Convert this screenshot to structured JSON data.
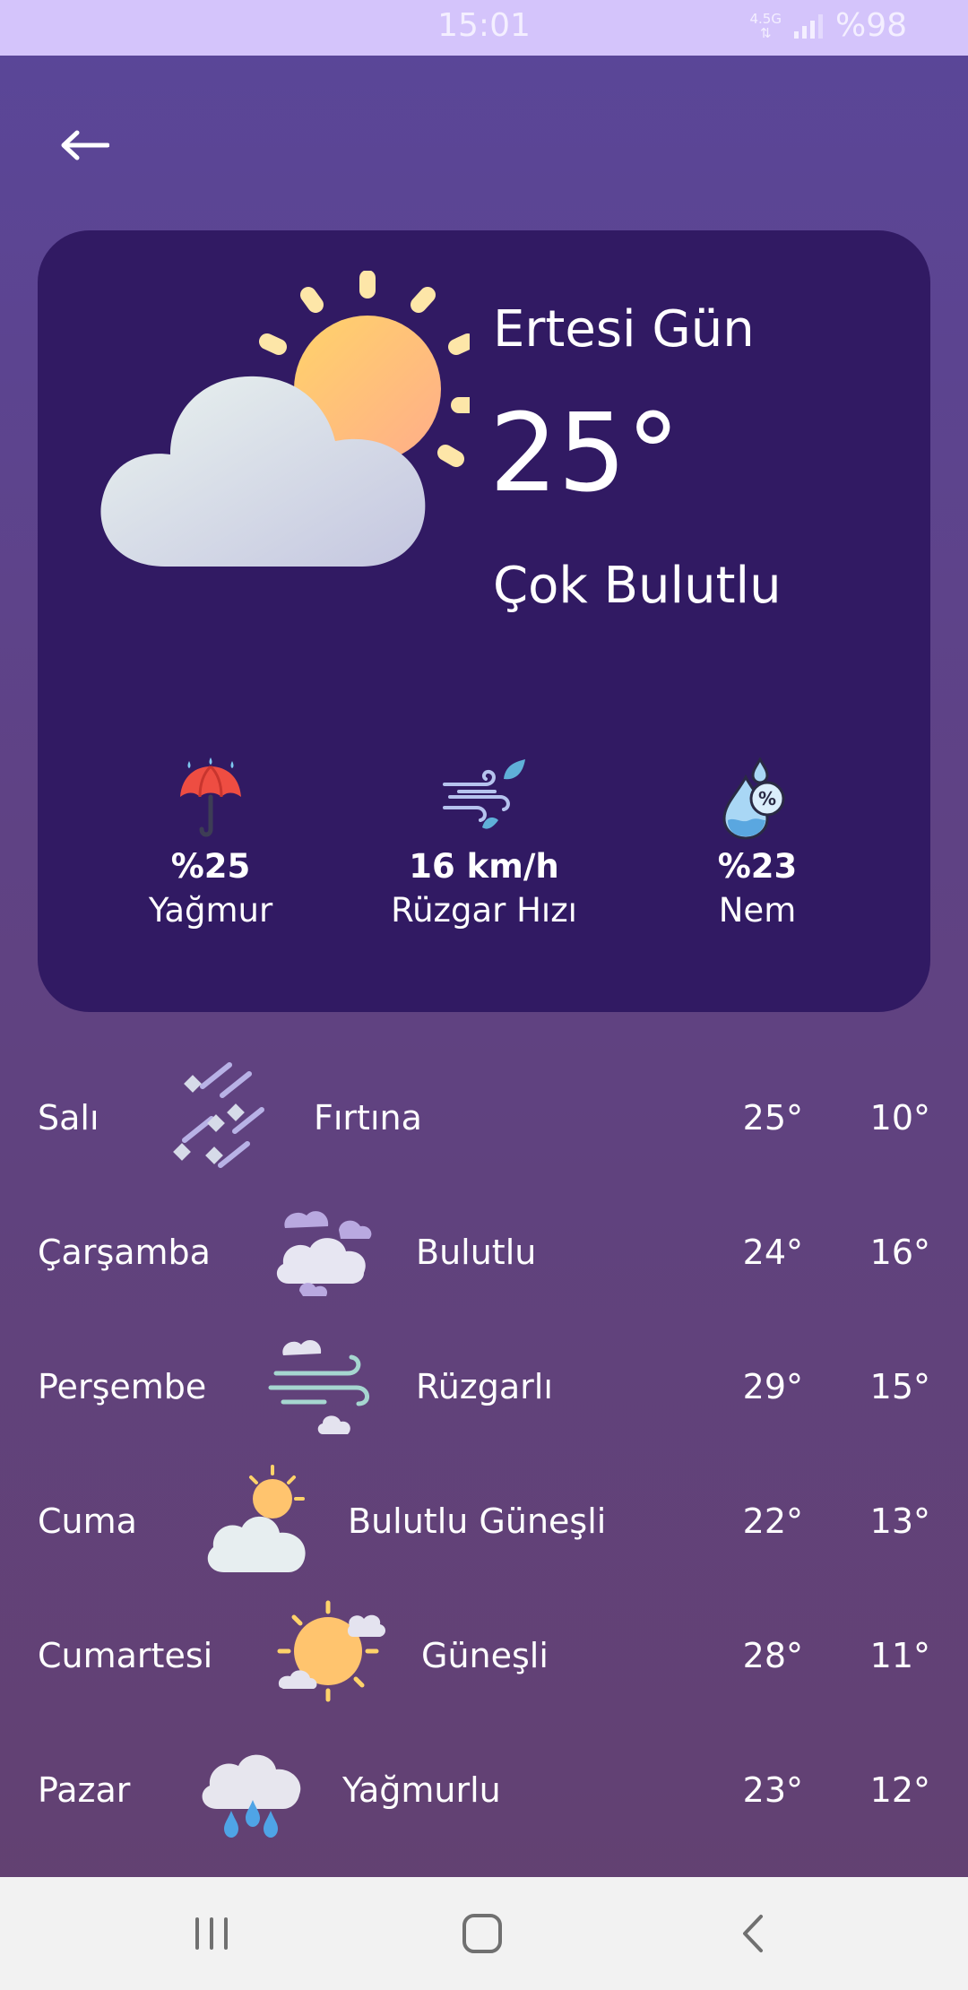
{
  "status_bar": {
    "time": "15:01",
    "network": "4.5G",
    "battery": "%98"
  },
  "hero": {
    "day": "Ertesi Gün",
    "temperature": "25°",
    "condition": "Çok Bulutlu",
    "icon": "sun-behind-cloud-icon"
  },
  "stats": [
    {
      "icon": "umbrella-rain-icon",
      "value": "%25",
      "label": "Yağmur"
    },
    {
      "icon": "wind-icon",
      "value": "16 km/h",
      "label": "Rüzgar Hızı"
    },
    {
      "icon": "humidity-drop-icon",
      "value": "%23",
      "label": "Nem"
    }
  ],
  "forecast": [
    {
      "day": "Salı",
      "icon": "storm-icon",
      "condition": "Fırtına",
      "high": "25°",
      "low": "10°"
    },
    {
      "day": "Çarşamba",
      "icon": "cloudy-icon",
      "condition": "Bulutlu",
      "high": "24°",
      "low": "16°"
    },
    {
      "day": "Perşembe",
      "icon": "windy-icon",
      "condition": "Rüzgarlı",
      "high": "29°",
      "low": "15°"
    },
    {
      "day": "Cuma",
      "icon": "partly-sunny-icon",
      "condition": "Bulutlu Güneşli",
      "high": "22°",
      "low": "13°"
    },
    {
      "day": "Cumartesi",
      "icon": "sunny-icon",
      "condition": "Güneşli",
      "high": "28°",
      "low": "11°"
    },
    {
      "day": "Pazar",
      "icon": "rain-icon",
      "condition": "Yağmurlu",
      "high": "23°",
      "low": "12°"
    }
  ],
  "colors": {
    "card": "#311a63",
    "status_bar": "#d4c4fb",
    "nav_bar": "#f2f2f2"
  }
}
